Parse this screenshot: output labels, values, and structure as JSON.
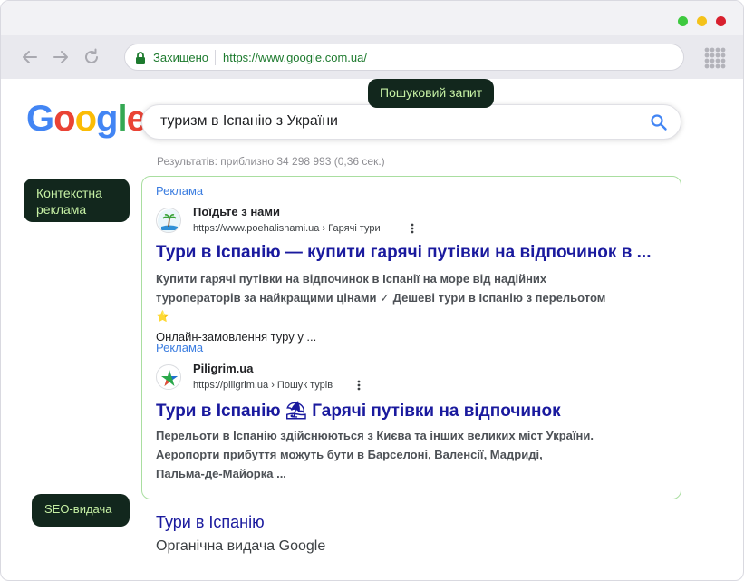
{
  "browser": {
    "secure_label": "Захищено",
    "url": "https://www.google.com.ua/"
  },
  "google": {
    "logo_letters": [
      "G",
      "o",
      "o",
      "g",
      "l",
      "e"
    ],
    "logo_colors": [
      "#4285F4",
      "#EA4335",
      "#FBBC05",
      "#4285F4",
      "#34A853",
      "#EA4335"
    ]
  },
  "search": {
    "query": "туризм в Іспанію з України"
  },
  "annotations": {
    "query_tag": "Пошуковий запит",
    "context_tag_line1": "Контекстна",
    "context_tag_line2": "реклама",
    "seo_tag": "SEO-видача"
  },
  "results_stats": "Результатів: приблизно 34 298 993 (0,36 сек.)",
  "ads": [
    {
      "label": "Реклама",
      "site_name": "Поїдьте з нами",
      "site_url": "https://www.poehalisnami.ua › Гарячі тури",
      "title": "Тури в Іспанію — купити гарячі путівки на відпочинок в ...",
      "desc_line1": "Купити гарячі путівки на відпочинок в Іспанії на море від надійних",
      "desc_line2": "туроператорів за найкращими цінами ✓ Дешеві тури в Іспанію з перельотом",
      "desc_line3": "⭐",
      "extra": "Онлайн-замовлення туру у ..."
    },
    {
      "label": "Реклама",
      "site_name": "Piligrim.ua",
      "site_url": "https://piligrim.ua › Пошук турів",
      "title": "Тури в Іспанію ⛱ Гарячі путівки на відпочинок",
      "desc_line1": "Перельоти в Іспанію здійснюються з Києва та інших великих міст України.",
      "desc_line2": "Аеропорти прибуття можуть бути в Барселоні, Валенсії, Мадриді,",
      "desc_line3": "Пальма-де-Майорка ..."
    }
  ],
  "organic": {
    "title": "Тури в Іспанію",
    "desc": "Органічна видача Google"
  },
  "colors": {
    "tag_bg": "#12271d",
    "tag_text": "#c6f0a4",
    "ad_border": "#a9dea0",
    "link": "#1a1a9e",
    "ad_label": "#3b7de0",
    "secure": "#1d7a2e"
  }
}
